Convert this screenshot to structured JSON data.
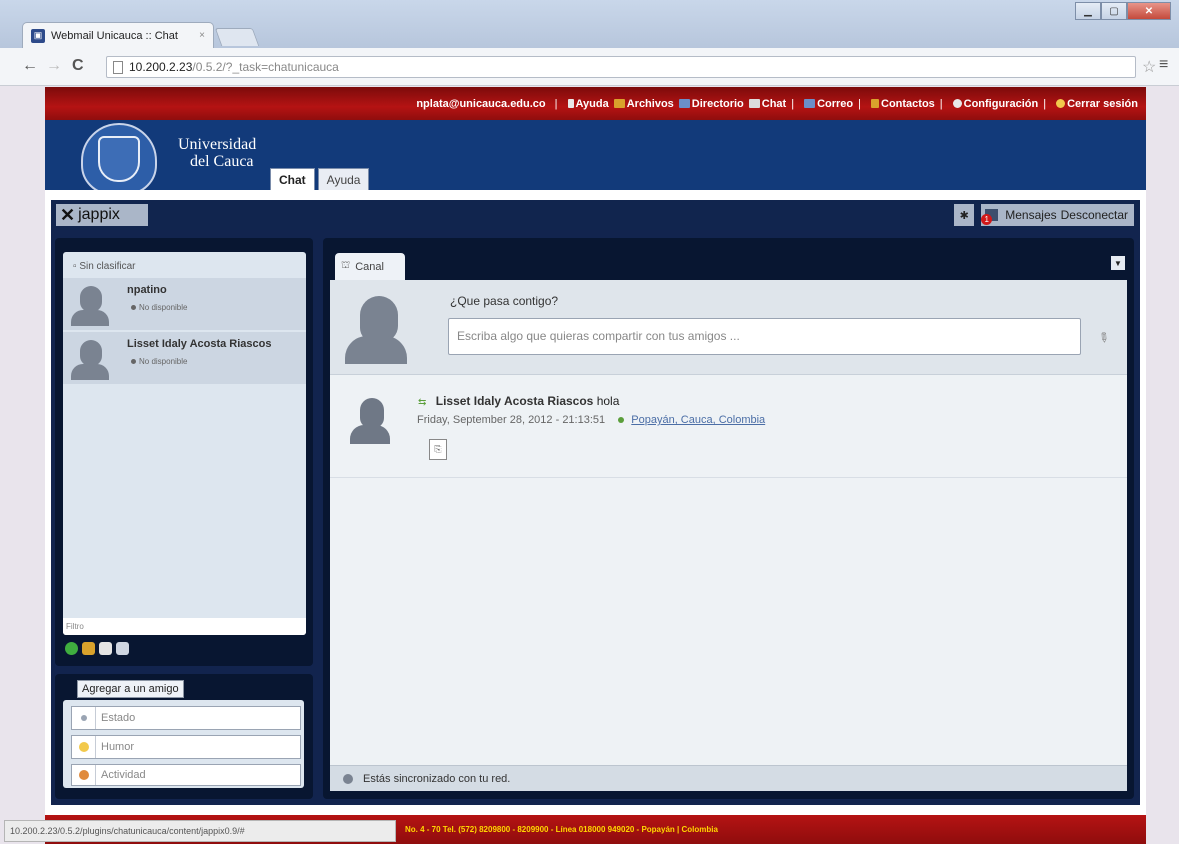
{
  "browser": {
    "tab_title": "Webmail Unicauca :: Chat",
    "tab_close": "×",
    "url_host": "10.200.2.23",
    "url_path": "/0.5.2/?_task=chatunicauca",
    "status_url": "10.200.2.23/0.5.2/plugins/chatunicauca/content/jappix0.9/#"
  },
  "topbar": {
    "email": "nplata@unicauca.edu.co",
    "sep": "|",
    "links": {
      "ayuda": "Ayuda",
      "archivos": "Archivos",
      "directorio": "Directorio",
      "chat": "Chat",
      "correo": "Correo",
      "contactos": "Contactos",
      "configuracion": "Configuración",
      "cerrar": "Cerrar sesión"
    },
    "colors": {
      "bar": "#b51313",
      "header": "#123a7a"
    }
  },
  "header": {
    "university_line1": "Universidad",
    "university_line2": "del Cauca",
    "tabs": {
      "chat": "Chat",
      "ayuda": "Ayuda"
    }
  },
  "jappix": {
    "logo_text": "jappix",
    "messages_label": "Mensajes",
    "disconnect_label": "Desconectar",
    "unread_count": "1"
  },
  "roster": {
    "group": "Sin clasificar",
    "buddies": [
      {
        "name": "npatino",
        "status": "No disponible"
      },
      {
        "name": "Lisset Idaly Acosta Riascos",
        "status": "No disponible"
      }
    ],
    "filter_placeholder": "Filtro"
  },
  "mood": {
    "tooltip": "Agregar a un amigo",
    "estado": "Estado",
    "humor": "Humor",
    "actividad": "Actividad"
  },
  "channel": {
    "tab_label": "Canal",
    "question": "¿Que pasa contigo?",
    "input_placeholder": "Escriba algo que quieras compartir con tus amigos ...",
    "post": {
      "author": "Lisset Idaly Acosta Riascos",
      "text": "hola",
      "date": "Friday, September 28, 2012 - 21:13:51",
      "location": "Popayán, Cauca, Colombia"
    },
    "status_text": "Estás sincronizado con tu red."
  },
  "footer": {
    "text": "No. 4 - 70 Tel. (572) 8209800 - 8209900 - Línea 018000 949020 - Popayán | Colombia"
  }
}
